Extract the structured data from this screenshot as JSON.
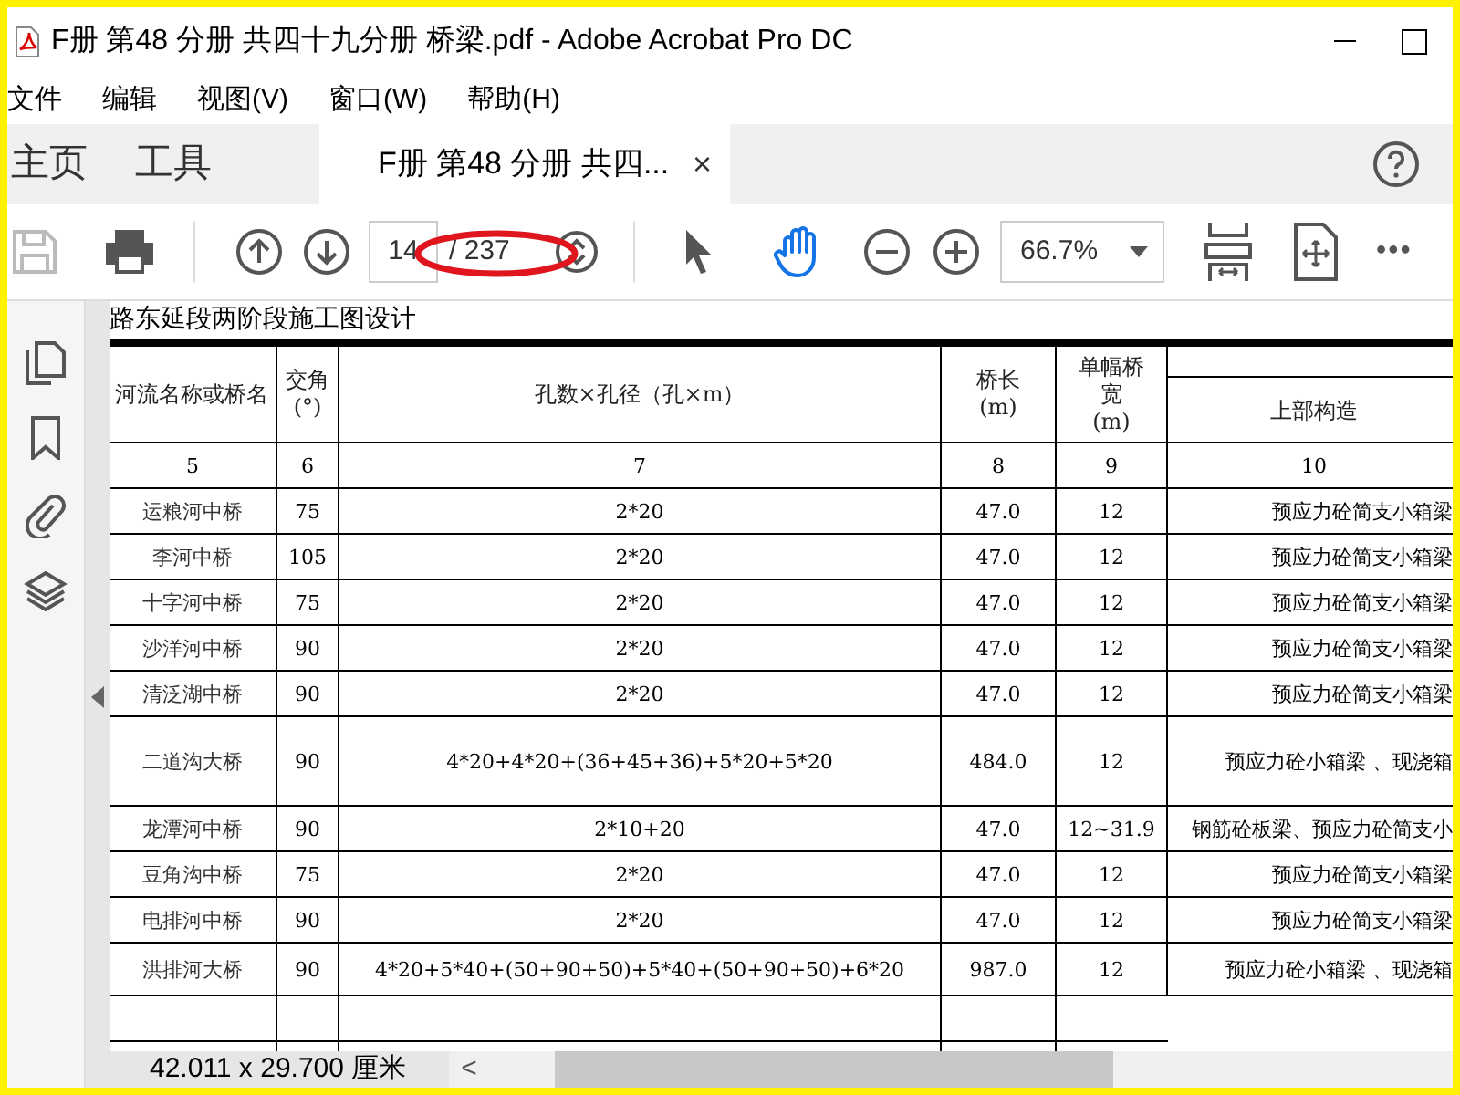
{
  "window": {
    "title": "F册 第48 分册 共四十九分册 桥梁.pdf - Adobe Acrobat Pro DC"
  },
  "menu": [
    "文件",
    "编辑",
    "视图(V)",
    "窗口(W)",
    "帮助(H)"
  ],
  "tabs": [
    {
      "label": "主页",
      "selected": false
    },
    {
      "label": "工具",
      "selected": false
    },
    {
      "label": "F册 第48 分册 共四...",
      "selected": true,
      "close": "×"
    }
  ],
  "toolbar": {
    "save_disabled": true,
    "page": "14",
    "page_total": "/ 237",
    "zoom": "66.7%",
    "tools": [
      {
        "kind": "select",
        "selected": false
      },
      {
        "kind": "hand",
        "selected": true
      }
    ],
    "more": "•••"
  },
  "document": {
    "heading": "路东延段两阶段施工图设计",
    "table": {
      "columns": [
        "河流名称或桥名",
        "交角\n(°)",
        "孔数×孔径（孔×m）",
        "桥长\n(m)",
        "单幅桥宽\n(m)",
        "上部构造"
      ],
      "column_numbers": [
        "5",
        "6",
        "7",
        "8",
        "9",
        "10"
      ],
      "rows": [
        {
          "kind": "normal",
          "cells": [
            "运粮河中桥",
            "75",
            "2*20",
            "47.0",
            "12",
            "预应力砼简支小箱梁"
          ]
        },
        {
          "kind": "normal",
          "cells": [
            "李河中桥",
            "105",
            "2*20",
            "47.0",
            "12",
            "预应力砼简支小箱梁"
          ]
        },
        {
          "kind": "normal",
          "cells": [
            "十字河中桥",
            "75",
            "2*20",
            "47.0",
            "12",
            "预应力砼简支小箱梁"
          ]
        },
        {
          "kind": "normal",
          "cells": [
            "沙洋河中桥",
            "90",
            "2*20",
            "47.0",
            "12",
            "预应力砼简支小箱梁"
          ]
        },
        {
          "kind": "normal",
          "cells": [
            "清泛湖中桥",
            "90",
            "2*20",
            "47.0",
            "12",
            "预应力砼简支小箱梁"
          ]
        },
        {
          "kind": "tall",
          "cells": [
            "二道沟大桥",
            "90",
            "4*20+4*20+(36+45+36)+5*20+5*20",
            "484.0",
            "12",
            "预应力砼小箱梁 、现浇箱"
          ]
        },
        {
          "kind": "normal",
          "cells": [
            "龙潭河中桥",
            "90",
            "2*10+20",
            "47.0",
            "12~31.9",
            "钢筋砼板梁、预应力砼简支小"
          ]
        },
        {
          "kind": "normal",
          "cells": [
            "豆角沟中桥",
            "75",
            "2*20",
            "47.0",
            "12",
            "预应力砼简支小箱梁"
          ]
        },
        {
          "kind": "normal",
          "cells": [
            "电排河中桥",
            "90",
            "2*20",
            "47.0",
            "12",
            "预应力砼简支小箱梁"
          ]
        },
        {
          "kind": "medium",
          "cells": [
            "洪排河大桥",
            "90",
            "4*20+5*40+(50+90+50)+5*40+(50+90+50)+6*20",
            "987.0",
            "12",
            "预应力砼小箱梁 、现浇箱"
          ]
        }
      ]
    }
  },
  "status_bar": {
    "page_size": "42.011 x 29.700 厘米",
    "scroll_left": "<"
  }
}
